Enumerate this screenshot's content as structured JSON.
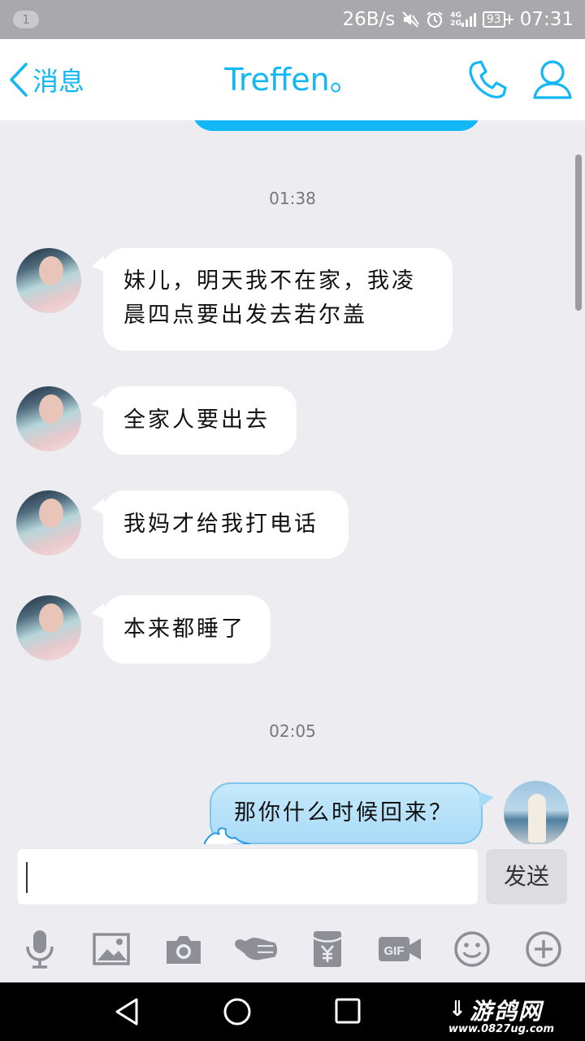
{
  "status_bar": {
    "notification_count": "1",
    "network_speed": "26B/s",
    "network_type_top": "4G",
    "network_type_bottom": "2G",
    "battery": "93",
    "time": "07:31",
    "icons": [
      "mute-icon",
      "alarm-icon",
      "signal-icon",
      "battery-icon"
    ]
  },
  "header": {
    "back_label": "消息",
    "title": "Treffen。",
    "accent_color": "#12b7f5"
  },
  "messages": [
    {
      "type": "time",
      "text": "01:38"
    },
    {
      "type": "incoming",
      "text_lines": [
        "妹儿，明天我不在家，我凌",
        "晨四点要出发去若尔盖"
      ]
    },
    {
      "type": "incoming",
      "text": "全家人要出去"
    },
    {
      "type": "incoming",
      "text": "我妈才给我打电话"
    },
    {
      "type": "incoming",
      "text": "本来都睡了"
    },
    {
      "type": "time",
      "text": "02:05"
    },
    {
      "type": "outgoing",
      "text": "那你什么时候回来？"
    }
  ],
  "input": {
    "value": "",
    "send_label": "发送"
  },
  "toolbar": {
    "icons": [
      "microphone-icon",
      "image-icon",
      "camera-icon",
      "poke-icon",
      "red-packet-icon",
      "gif-icon",
      "emoji-icon",
      "plus-icon"
    ]
  },
  "watermark": {
    "main": "游鸽网",
    "url": "www.0827ug.com"
  }
}
